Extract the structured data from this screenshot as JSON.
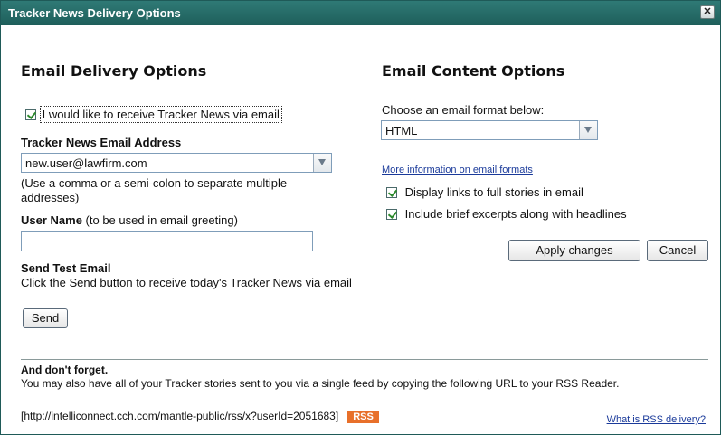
{
  "window": {
    "title": "Tracker News Delivery Options",
    "close_icon": "close-icon"
  },
  "email_delivery": {
    "heading": "Email Delivery Options",
    "receive_checkbox_label": "I would like to receive Tracker News via email",
    "receive_checked": true,
    "address_label": "Tracker News Email Address",
    "address_value": "new.user@lawfirm.com",
    "address_hint": "(Use a comma or a semi-colon to separate multiple addresses)",
    "username_label": "User Name",
    "username_hint": " (to be used in email greeting)",
    "username_value": "",
    "test_heading": "Send Test Email",
    "test_text": "Click the Send button to receive today's Tracker News via email",
    "send_button": "Send"
  },
  "email_content": {
    "heading": "Email Content Options",
    "format_prompt": "Choose an email format below:",
    "format_value": "HTML",
    "more_info_link": "More information on email formats",
    "option_links": "Display links to full stories in email",
    "option_links_checked": true,
    "option_excerpts": "Include brief excerpts along with headlines",
    "option_excerpts_checked": true,
    "apply_button": "Apply changes",
    "cancel_button": "Cancel"
  },
  "footer": {
    "heading": "And don't forget.",
    "text": "You may also have all of your Tracker stories sent to you via a single feed by copying the following URL to your RSS Reader.",
    "url": "[http://intelliconnect.cch.com/mantle-public/rss/x?userId=2051683]",
    "rss_badge": "RSS",
    "rss_help_link": "What is RSS delivery?"
  },
  "colors": {
    "titlebar": "#1e5e5a",
    "rss_badge": "#e8702a",
    "link": "#1a3a9a"
  }
}
